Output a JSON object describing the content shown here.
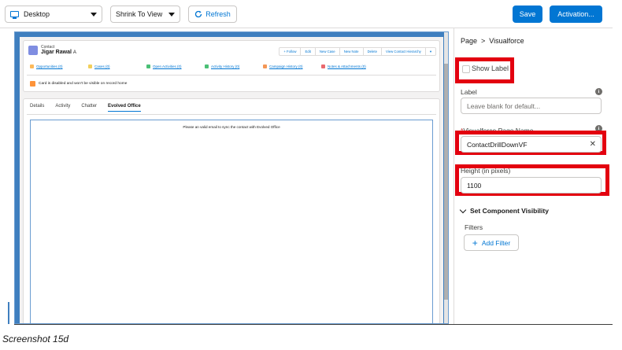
{
  "toolbar": {
    "device_value": "Desktop",
    "view_mode_value": "Shrink To View",
    "refresh_label": "Refresh",
    "save_label": "Save",
    "activation_label": "Activation..."
  },
  "preview": {
    "record_type": "Contact",
    "record_name": "Jigar Rawal",
    "record_suffix": "A",
    "actions": [
      "+ Follow",
      "Edit",
      "New Case",
      "New Note",
      "Delete",
      "View Contact Hierarchy",
      "▾"
    ],
    "related": [
      {
        "label": "Opportunities (0)",
        "color": "#fcb95b"
      },
      {
        "label": "Cases (0)",
        "color": "#f2cf5b"
      },
      {
        "label": "Open Activities (0)",
        "color": "#4bc076"
      },
      {
        "label": "Activity History (0)",
        "color": "#4bc076"
      },
      {
        "label": "Campaign History (0)",
        "color": "#f49756"
      },
      {
        "label": "Notes & Attachments (0)",
        "color": "#e9696e"
      }
    ],
    "card_warning": "Card is disabled and won't be visible on record home",
    "tabs": [
      "Details",
      "Activity",
      "Chatter",
      "Evolved Office"
    ],
    "vf_message": "Please an valid email to sync the contact with Evolved Office"
  },
  "panel": {
    "breadcrumb_root": "Page",
    "breadcrumb_sep": ">",
    "breadcrumb_current": "Visualforce",
    "show_label": "Show Label",
    "label_field_label": "Label",
    "label_placeholder": "Leave blank for default...",
    "vf_page_label": "Visualforce Page Name",
    "vf_page_required": "*",
    "vf_page_value": "ContactDrillDownVF",
    "height_label": "Height (in pixels)",
    "height_value": "1100",
    "visibility_label": "Set Component Visibility",
    "filters_label": "Filters",
    "add_filter_label": "Add Filter"
  },
  "caption": "Screenshot 15d",
  "colors": {
    "brand": "#0176d3",
    "highlight": "#e3000f"
  }
}
